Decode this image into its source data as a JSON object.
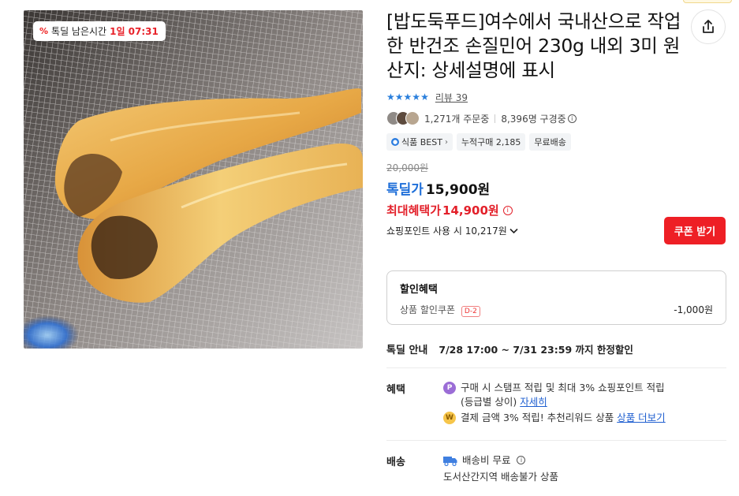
{
  "timer": {
    "icon": "percent-icon",
    "label": "톡딜 남은시간",
    "remaining": "1일 07:31"
  },
  "product": {
    "title": "[밥도둑푸드]여수에서 국내산으로 작업한 반건조 손질민어 230g 내외 3미 원산지: 상세설명에 표시",
    "rating_stars": 5,
    "review_label": "리뷰 39",
    "orders": "1,271개 주문중",
    "viewers": "8,396명 구경중",
    "badges": [
      {
        "label": "식품 BEST",
        "icon": "badge-icon",
        "chevron": "›"
      },
      {
        "label": "누적구매 2,185"
      },
      {
        "label": "무료배송"
      }
    ]
  },
  "price": {
    "original": "20,000원",
    "deal_label": "톡딜가",
    "deal_price": "15,900원",
    "max_label": "최대혜택가",
    "max_price": "14,900원",
    "coupon_button": "쿠폰 받기",
    "points": "쇼핑포인트 사용 시 10,217원"
  },
  "benefit_box": {
    "title": "할인혜택",
    "item_label": "상품 할인쿠폰",
    "item_tag": "D-2",
    "item_amount": "-1,000원"
  },
  "deal_info": {
    "label": "톡딜 안내",
    "value": "7/28 17:00 ~ 7/31 23:59 까지 한정할인"
  },
  "benefits": {
    "label": "혜택",
    "line1": "구매 시 스탬프 적립 및 최대 3% 쇼핑포인트 적립",
    "line1b": "(등급별 상이)",
    "line1_link": "자세히",
    "line2": "결제 금액 3% 적립! 추천리워드 상품",
    "line2_link": "상품 더보기",
    "icon1": "P",
    "icon2": "W"
  },
  "shipping": {
    "label": "배송",
    "fee": "배송비 무료",
    "note": "도서산간지역 배송불가 상품"
  },
  "colors": {
    "accent_blue": "#1f6fd9",
    "accent_red": "#e3202a",
    "coupon_red": "#ee1f25"
  }
}
